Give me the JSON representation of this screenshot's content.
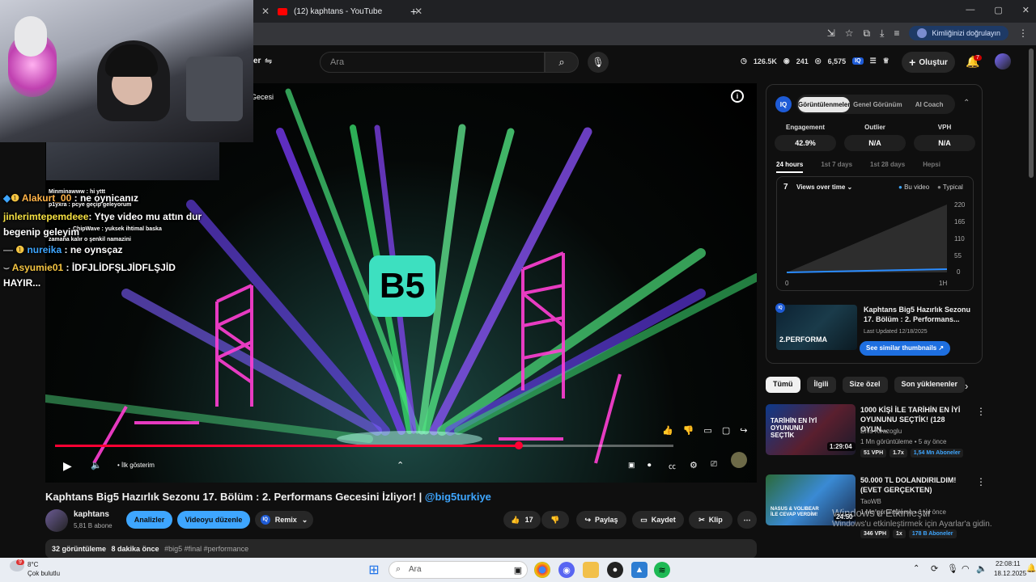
{
  "browser": {
    "tab_title": "(12) kaphtans - YouTube",
    "new_tab": "+",
    "verify_label": "Kimliğinizi doğrulayın",
    "window_controls": [
      "—",
      "▢",
      "✕"
    ]
  },
  "header": {
    "filters_label": "er",
    "search_placeholder": "Ara",
    "stats": {
      "subs": "126.5K",
      "views": "241",
      "eye": "6,575"
    },
    "create_label": "Oluştur",
    "notif_count": "7"
  },
  "video": {
    "overlay_title": "Gecesi",
    "logo": "B5",
    "progress_fraction": 0.75,
    "chapter_label": "İlk gösterim",
    "colors": {
      "progress": "#ff0033",
      "accent": "#3ea6ff"
    }
  },
  "meta": {
    "title": "Kaphtans Big5 Hazırlık Sezonu 17. Bölüm : 2. Performans Gecesini İzliyor! | ",
    "title_tag": "@big5turkiye",
    "channel": "kaphtans",
    "subs": "5,81 B abone",
    "analytics_btn": "Analizler",
    "edit_btn": "Videoyu düzenle",
    "remix_btn": "Remix",
    "likes": "17",
    "share": "Paylaş",
    "save": "Kaydet",
    "clip": "Klip",
    "desc_views": "32 görüntüleme",
    "desc_time": "8 dakika önce",
    "desc_tags": "#big5 #final #performance"
  },
  "iq": {
    "tabs": [
      "Görüntülenmeler",
      "Genel Görünüm",
      "AI Coach"
    ],
    "metrics": [
      {
        "label": "Engagement",
        "value": "42.9%"
      },
      {
        "label": "Outlier",
        "value": "N/A"
      },
      {
        "label": "VPH",
        "value": "N/A"
      }
    ],
    "time_tabs": [
      "24 hours",
      "1st 7 days",
      "1st 28 days",
      "Hepsi"
    ],
    "chart_count": "7",
    "chart_title": "Views over time",
    "legend_this": "Bu video",
    "legend_typical": "Typical",
    "y_ticks": [
      "220",
      "165",
      "110",
      "55",
      "0"
    ],
    "x_ticks": [
      "0",
      "1H"
    ],
    "thumb_title": "Kaphtans Big5 Hazırlık Sezonu 17. Bölüm : 2. Performans...",
    "thumb_updated": "Last Updated 12/18/2025",
    "thumb_text": "2.PERFORMA",
    "see_similar": "See similar thumbnails ↗"
  },
  "chips": [
    "Tümü",
    "İlgili",
    "Size özel",
    "Son yüklenenler"
  ],
  "recs": [
    {
      "title": "1000 KİŞİ İLE TARİHİN EN İYİ OYUNUNU SEÇTİK! (128 OYUN...",
      "channel": "Enis Kirazoglu",
      "meta": "1 Mn görüntüleme • 5 ay önce",
      "duration": "1:29:04",
      "thumb_text": "TARİHİN EN İYİ OYUNUNU SEÇTİK",
      "vph": "51 VPH",
      "mult": "1.7x",
      "subs": "1,54 Mn Aboneler"
    },
    {
      "title": "50.000 TL DOLANDIRILDIM! (EVET GERÇEKTEN)",
      "channel": "TaoWB",
      "meta": "1 Mn görüntüleme • 1 yıl önce",
      "duration": "24:50",
      "thumb_text": "NASUS & VOLIBEAR İLE CEVAP VERDİM!",
      "vph": "346 VPH",
      "mult": "1x",
      "subs": "178 B Aboneler"
    }
  ],
  "chat": [
    {
      "user": "Alakurt_00",
      "msg": ": ne oynicanız"
    },
    {
      "user": "jinlerimtepemdeee",
      "msg": ": Ytye video mu attın dur"
    },
    {
      "user": "",
      "msg": "begenip geleyim"
    },
    {
      "user": "nureika",
      "msg": ": ne oynsçaz"
    },
    {
      "user": "Asyumie01",
      "msg": ": İDFJLİDFŞLJİDFLŞJİD"
    },
    {
      "user": "",
      "msg": "HAYIR..."
    }
  ],
  "chat_small": [
    "Minminawww : hi yttt",
    "p1yxra : pcye geçip geleyorum",
    "ChipWave : yuksek ihtimal baska",
    "zamana kalır o şenkil namazini"
  ],
  "activate": {
    "line1": "Windows'u Etkinleştir",
    "line2": "Windows'u etkinleştirmek için Ayarlar'a gidin."
  },
  "taskbar": {
    "weather_temp": "8°C",
    "weather_desc": "Çok bulutlu",
    "weather_badge": "9",
    "search_label": "Ara",
    "time": "22:08:11",
    "date": "18.12.2025"
  }
}
